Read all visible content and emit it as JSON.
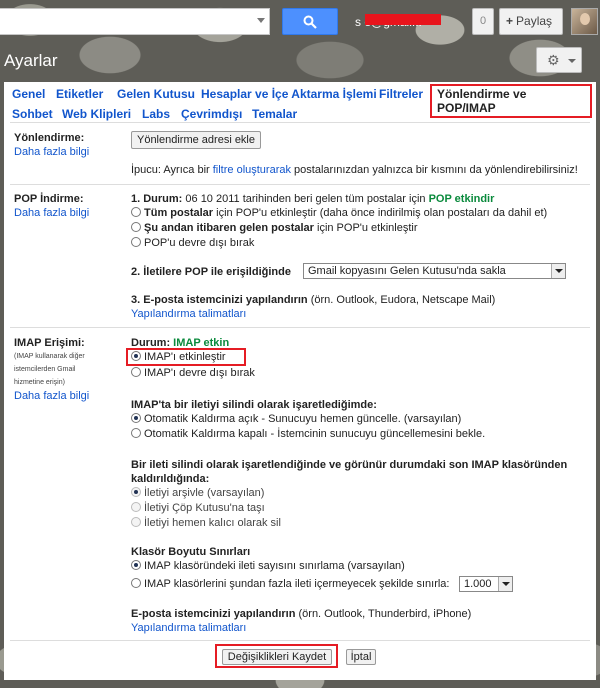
{
  "topbar": {
    "search_placeholder": "",
    "user_email": "s                e@gmail...",
    "notification_count": "0",
    "share_label": "Paylaş"
  },
  "page": {
    "title": "Ayarlar"
  },
  "tabs": [
    "Genel",
    "Etiketler",
    "Gelen Kutusu",
    "Hesaplar ve İçe Aktarma İşlemi",
    "Filtreler",
    "Yönlendirme ve POP/IMAP",
    "Sohbet",
    "Web Klipleri",
    "Labs",
    "Çevrimdışı",
    "Temalar"
  ],
  "forwarding": {
    "label": "Yönlendirme:",
    "learn_more": "Daha fazla bilgi",
    "add_button": "Yönlendirme adresi ekle",
    "tip_prefix": "İpucu: Ayrıca bir ",
    "tip_link": "filtre oluşturarak",
    "tip_suffix": " postalarınızdan yalnızca bir kısmını da yönlendirebilirsiniz!"
  },
  "pop": {
    "label": "POP İndirme:",
    "learn_more": "Daha fazla bilgi",
    "status_prefix": "1. Durum:",
    "status_text": " 06 10 2011 tarihinden beri gelen tüm postalar için ",
    "status_value": "POP etkindir",
    "opt1_bold": "Tüm postalar",
    "opt1_rest": " için POP'u etkinleştir (daha önce indirilmiş olan postaları da dahil et)",
    "opt2_bold": "Şu andan itibaren gelen postalar",
    "opt2_rest": " için POP'u etkinleştir",
    "opt3": "POP'u devre dışı bırak",
    "step2_label": "2. İletilere POP ile erişildiğinde",
    "step2_select": "Gmail kopyasını Gelen Kutusu'nda sakla",
    "step3_label": "3. E-posta istemcinizi yapılandırın",
    "step3_hint": " (örn. Outlook, Eudora, Netscape Mail)",
    "step3_link": "Yapılandırma talimatları"
  },
  "imap": {
    "label": "IMAP Erişimi:",
    "note_lines": [
      "(IMAP kullanarak diğer",
      "istemcilerden Gmail",
      "hizmetine erişin)"
    ],
    "learn_more": "Daha fazla bilgi",
    "status_prefix": "Durum:",
    "status_value": "IMAP etkin",
    "enable": "IMAP'ı etkinleştir",
    "disable": "IMAP'ı devre dışı bırak",
    "delete_heading": "IMAP'ta bir iletiyi silindi olarak işaretlediğimde:",
    "auto_on": "Otomatik Kaldırma açık - Sunucuyu hemen güncelle. (varsayılan)",
    "auto_off": "Otomatik Kaldırma kapalı - İstemcinin sunucuyu güncellemesini bekle.",
    "expunge_heading_1": "Bir ileti silindi olarak işaretlendiğinde ve görünür durumdaki son IMAP klasöründen",
    "expunge_heading_2": "kaldırıldığında:",
    "archive": "İletiyi arşivle (varsayılan)",
    "trash": "İletiyi Çöp Kutusu'na taşı",
    "delete_forever": "İletiyi hemen kalıcı olarak sil",
    "folder_heading": "Klasör Boyutu Sınırları",
    "no_limit": "IMAP klasöründeki ileti sayısını sınırlama (varsayılan)",
    "limit_prefix": "IMAP klasörlerini şundan fazla ileti içermeyecek şekilde sınırla:",
    "limit_value": "1.000",
    "client_label": "E-posta istemcinizi yapılandırın",
    "client_hint": " (örn. Outlook, Thunderbird, iPhone)",
    "client_link": "Yapılandırma talimatları"
  },
  "footer": {
    "save": "Değişiklikleri Kaydet",
    "cancel": "İptal"
  },
  "colors": {
    "link": "#1155cc",
    "accent": "#4d90fe",
    "highlight": "#e51c24",
    "status_green": "#0a8a3c"
  }
}
